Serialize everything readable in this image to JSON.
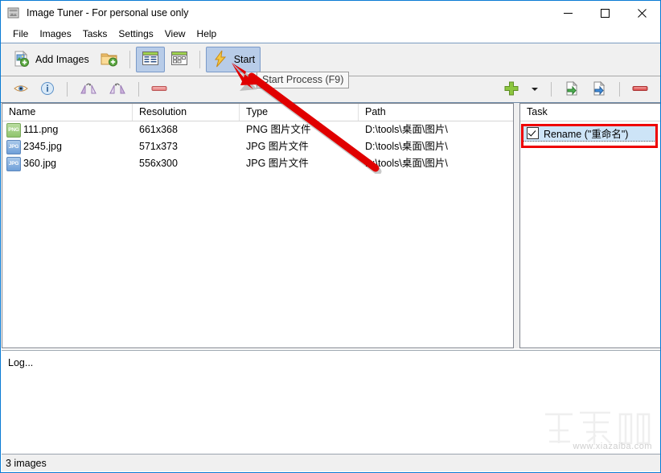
{
  "window": {
    "title": "Image Tuner - For personal use only",
    "app_icon": "app-window-icon",
    "minimize": "—",
    "maximize": "☐",
    "close": "✕"
  },
  "menubar": {
    "items": [
      {
        "label": "File"
      },
      {
        "label": "Images"
      },
      {
        "label": "Tasks"
      },
      {
        "label": "Settings"
      },
      {
        "label": "View"
      },
      {
        "label": "Help"
      }
    ]
  },
  "toolbar_main": {
    "add_images_label": "Add Images",
    "add_images_icon": "add-image-icon",
    "add_folder_icon": "add-folder-icon",
    "list_view_icon": "list-view-icon",
    "thumbnail_view_icon": "thumbnail-view-icon",
    "start_label": "Start",
    "start_icon": "lightning-bolt-icon"
  },
  "toolbar_second": {
    "preview_icon": "eye-preview-icon",
    "info_icon": "info-icon",
    "rotate_left_icon": "rotate-left-icon",
    "rotate_right_icon": "rotate-right-icon",
    "remove_image_icon": "remove-icon",
    "add_task_icon": "plus-icon",
    "add_task_dropdown_icon": "chevron-down-icon",
    "load_task_icon": "import-task-icon",
    "save_task_icon": "export-task-icon",
    "remove_task_icon": "remove-icon"
  },
  "tooltip": {
    "text": "Start Process (F9)"
  },
  "file_list": {
    "columns": [
      "Name",
      "Resolution",
      "Type",
      "Path"
    ],
    "rows": [
      {
        "icon": "png-file-icon",
        "icon_text": "PNG",
        "name": "111.png",
        "resolution": "661x368",
        "type": "PNG 图片文件",
        "path": "D:\\tools\\桌面\\图片\\"
      },
      {
        "icon": "jpg-file-icon",
        "icon_text": "JPG",
        "name": "2345.jpg",
        "resolution": "571x373",
        "type": "JPG 图片文件",
        "path": "D:\\tools\\桌面\\图片\\"
      },
      {
        "icon": "jpg-file-icon",
        "icon_text": "JPG",
        "name": "360.jpg",
        "resolution": "556x300",
        "type": "JPG 图片文件",
        "path": "D:\\tools\\桌面\\图片\\"
      }
    ]
  },
  "task_panel": {
    "column": "Task",
    "items": [
      {
        "label": "Rename (\"重命名\")",
        "checked": true
      }
    ]
  },
  "log": {
    "text": "Log..."
  },
  "statusbar": {
    "text": "3 images"
  },
  "watermark": {
    "url": "www.xiazaiba.com"
  },
  "colors": {
    "annotation_red": "#ee0000",
    "selected_blue": "#b8cce8",
    "task_selected": "#cde4f7",
    "window_border": "#0a7bd4",
    "toolbar_bg": "#f0f0f0"
  }
}
